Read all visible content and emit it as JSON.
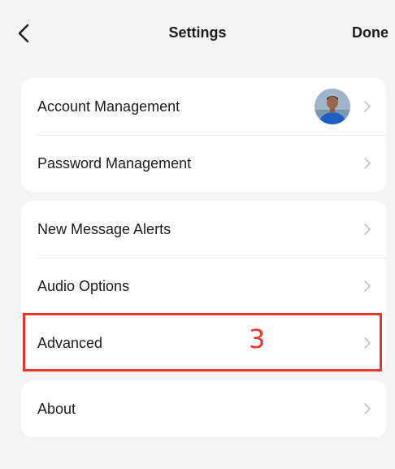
{
  "navbar": {
    "title": "Settings",
    "done_label": "Done"
  },
  "groups": [
    {
      "rows": [
        {
          "label": "Account Management",
          "has_avatar": true
        },
        {
          "label": "Password Management"
        }
      ]
    },
    {
      "rows": [
        {
          "label": "New Message Alerts"
        },
        {
          "label": "Audio Options"
        },
        {
          "label": "Advanced"
        }
      ]
    },
    {
      "rows": [
        {
          "label": "About"
        }
      ]
    }
  ],
  "annotation": {
    "step_number": "3",
    "highlight_color": "#e8352b",
    "highlighted_row": "Advanced"
  },
  "icons": {
    "back": "chevron-left-icon",
    "row_arrow": "chevron-right-icon",
    "avatar": "user-avatar"
  }
}
